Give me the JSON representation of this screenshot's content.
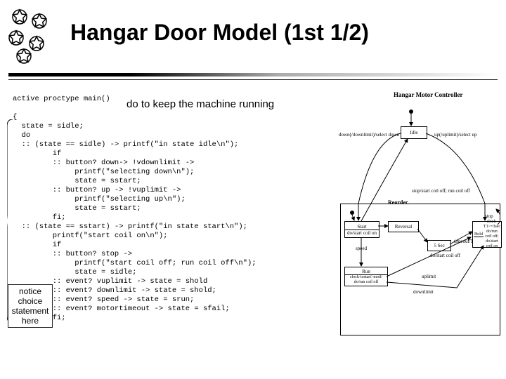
{
  "title": "Hangar Door Model (1st 1/2)",
  "annot_do": "do to keep the machine running",
  "notice": "notice\nchoice\nstatement\nhere",
  "code": "active proctype main()\n\n{\n  state = sidle;\n  do\n  :: (state == sidle) -> printf(\"in state idle\\n\");\n         if\n         :: button? down-> !vdownlimit ->\n              printf(\"selecting down\\n\");\n              state = sstart;\n         :: button? up -> !vuplimit ->\n              printf(\"selecting up\\n\");\n              state = sstart;\n         fi;\n  :: (state == sstart) -> printf(\"in state start\\n\");\n         printf(\"start coil on\\n\");\n         if\n         :: button? stop ->\n              printf(\"start coil off; run coil off\\n\");\n              state = sidle;\n         :: event? vuplimit -> state = shold\n         :: event? downlimit -> state = shold;\n         :: event? speed -> state = srun;\n         :: event? motortimeout -> state = sfail;\n         fi;",
  "diagram": {
    "hdr": "Hangar Motor Controller",
    "idle": "Idle",
    "evDown": "down(/downlimit)/select down",
    "evUp": "up(/uplimit)/select up",
    "evStop": "stop/start coil off; run coil off",
    "reorderTitle": "Reorder",
    "start": "Start",
    "reversal": "Reversal",
    "run": "Run",
    "hold": "Hold",
    "doStartCoil": "do/start coil on",
    "doStartCoilOff": "do/start coil off",
    "speed": "speed",
    "5sec": "5 Sec",
    "timeoutT1": "timeout/T1=clock",
    "clockT1": "clock-T1>=3sec\ndo/run coil off;\ndo/start coil on",
    "stop2": "stop",
    "runBody": "clock-tostart>motl/\ndo/run coil off",
    "uplimit": "uplimit",
    "downlimit": "downlimit"
  }
}
